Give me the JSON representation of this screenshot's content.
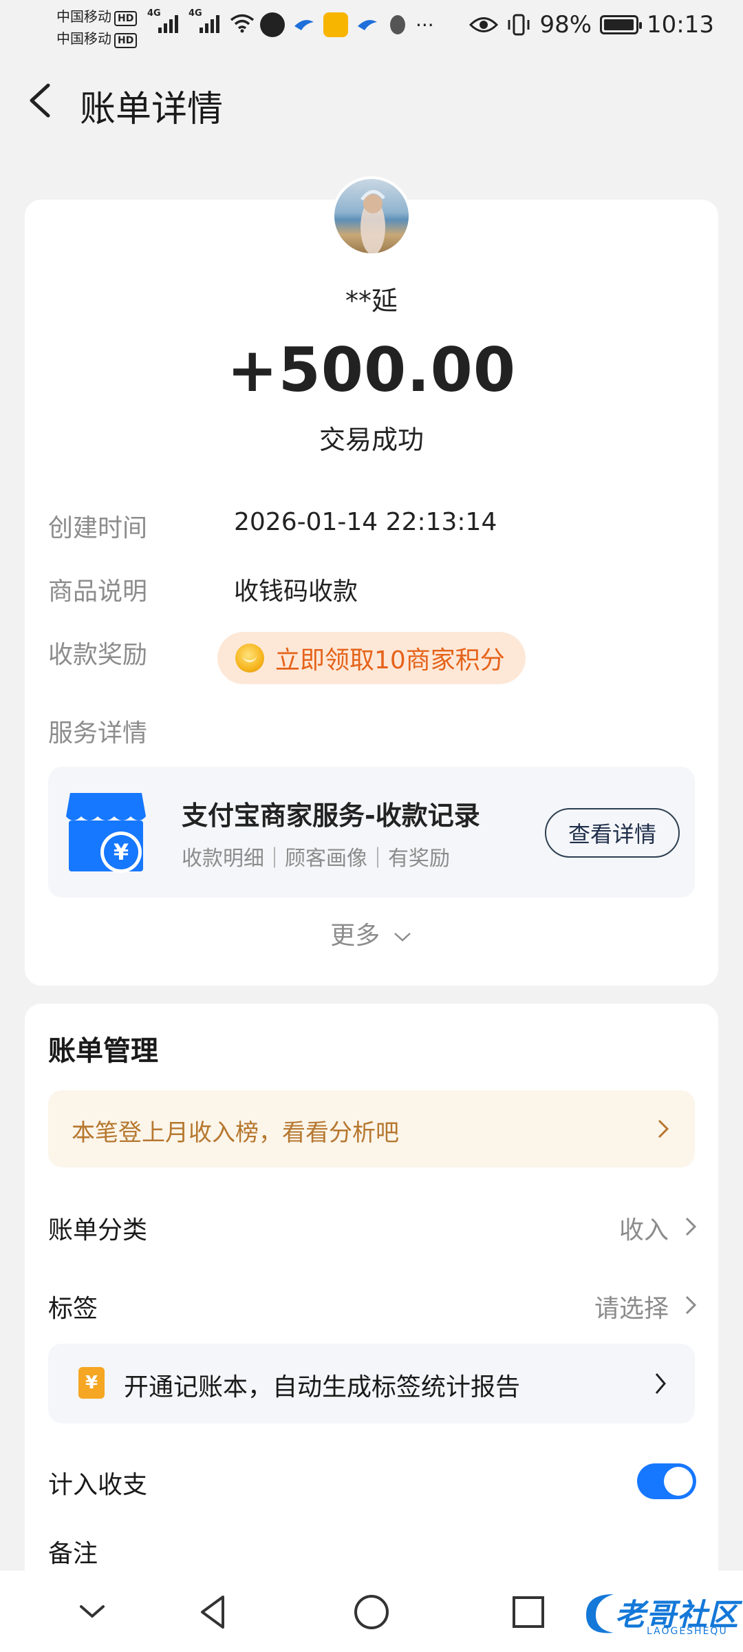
{
  "status_bar": {
    "carrier1": "中国移动",
    "carrier2": "中国移动",
    "hd": "HD",
    "net1": "4G",
    "net2": "4G",
    "battery_percent": "98%",
    "battery_level": 0.98,
    "time": "10:13"
  },
  "header": {
    "title": "账单详情"
  },
  "transaction": {
    "payer": "**延",
    "amount": "+500.00",
    "status": "交易成功",
    "created_label": "创建时间",
    "created_value": "2026-01-14 22:13:14",
    "desc_label": "商品说明",
    "desc_value": "收钱码收款",
    "reward_label": "收款奖励",
    "reward_value": "立即领取10商家积分",
    "service_label": "服务详情"
  },
  "service": {
    "title": "支付宝商家服务-收款记录",
    "subtitle": "收款明细｜顾客画像｜有奖励",
    "button": "查看详情",
    "icon_symbol": "¥"
  },
  "more_label": "更多",
  "management": {
    "title": "账单管理",
    "banner": "本笔登上月收入榜，看看分析吧",
    "category_label": "账单分类",
    "category_value": "收入",
    "tag_label": "标签",
    "tag_value": "请选择",
    "promo_text": "开通记账本，自动生成标签统计报告",
    "promo_icon": "¥",
    "include_label": "计入收支",
    "include_on": true,
    "note_label": "备注"
  },
  "watermark": {
    "text": "老哥社区",
    "sub": "LAOGESHEQU"
  },
  "colors": {
    "accent_blue": "#1677ff",
    "reward_orange": "#e5631a",
    "banner_gold": "#b6772e"
  }
}
